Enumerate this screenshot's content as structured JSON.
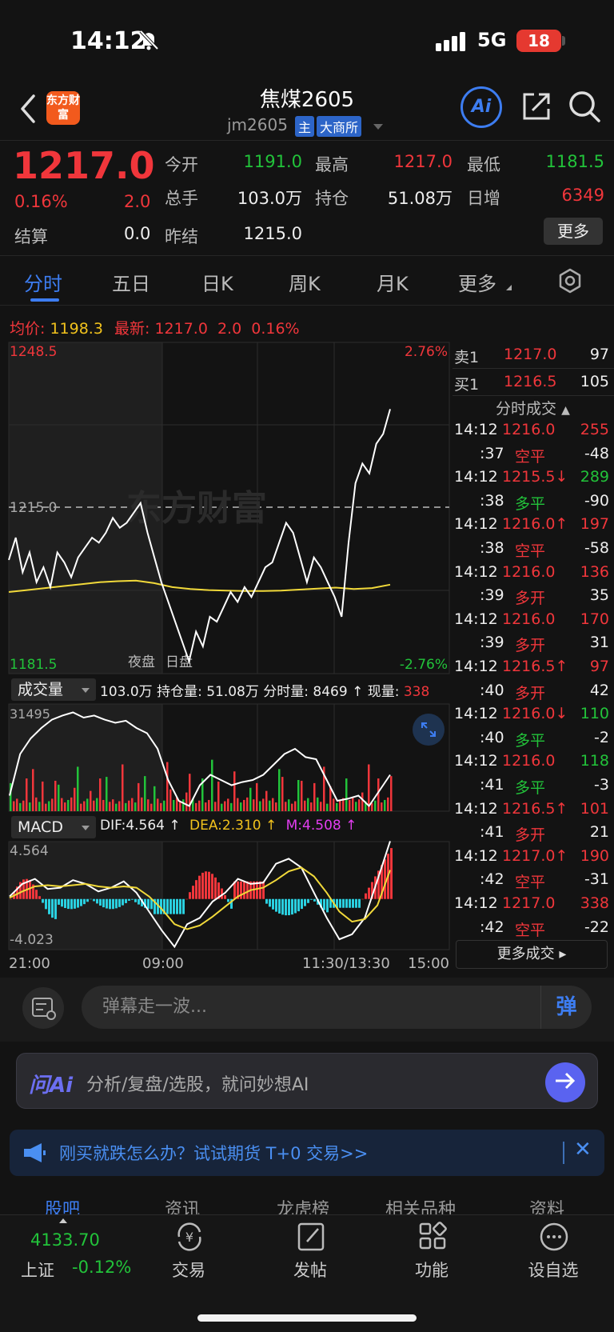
{
  "status": {
    "time": "14:12",
    "network": "5G",
    "battery": "18"
  },
  "header": {
    "logo": "东方财富",
    "title": "焦煤2605",
    "code": "jm2605",
    "tag_main": "主",
    "tag_exchange": "大商所"
  },
  "quote": {
    "price": "1217.0",
    "pct": "0.16%",
    "change": "2.0",
    "settle_label": "结算",
    "settle_value": "0.0",
    "open_label": "今开",
    "open_value": "1191.0",
    "high_label": "最高",
    "high_value": "1217.0",
    "low_label": "最低",
    "low_value": "1181.5",
    "vol_label": "总手",
    "vol_value": "103.0万",
    "oi_label": "持仓",
    "oi_value": "51.08万",
    "daily_inc_label": "日增",
    "daily_inc_value": "6349",
    "prev_settle_label": "昨结",
    "prev_settle_value": "1215.0",
    "more_label": "更多"
  },
  "tabs": [
    "分时",
    "五日",
    "日K",
    "周K",
    "月K",
    "更多"
  ],
  "info_line": {
    "avg_label": "均价:",
    "avg_value": "1198.3",
    "latest_label": "最新:",
    "latest_value": "1217.0",
    "latest_change": "2.0",
    "latest_pct": "0.16%"
  },
  "chart": {
    "price_high": "1248.5",
    "price_low": "1181.5",
    "price_ref": "1215.0",
    "pct_high": "2.76%",
    "pct_low": "-2.76%",
    "night_label": "夜盘",
    "day_label": "日盘",
    "watermark": "东方财富",
    "volume_selector": "成交量",
    "volume_info": "103.0万 持仓量: 51.08万 分时量: 8469 ↑ 现量:",
    "volume_now": "338",
    "volume_axis_max": "31495",
    "macd_selector": "MACD",
    "dif": "DIF:4.564 ↑",
    "dea": "DEA:2.310 ↑",
    "m": "M:4.508 ↑",
    "macd_max": "4.564",
    "macd_min": "-4.023",
    "time_ticks": [
      "21:00",
      "09:00",
      "11:30/13:30",
      "15:00"
    ],
    "colors": {
      "price_line": "#ffffff",
      "avg_line": "#f1d93a",
      "up": "#f0363b",
      "down": "#22c33a",
      "macd_neg": "#2ad0e0"
    }
  },
  "book": {
    "ask_label": "卖1",
    "ask_price": "1217.0",
    "ask_qty": "97",
    "bid_label": "买1",
    "bid_price": "1216.5",
    "bid_qty": "105",
    "trades_title": "分时成交",
    "trades": [
      {
        "t": "14:12",
        "p": "1216.0",
        "q": "255",
        "pc": "red",
        "qc": "red"
      },
      {
        "t": ":37",
        "p": "空平",
        "q": "-48",
        "pc": "red",
        "qc": "white"
      },
      {
        "t": "14:12",
        "p": "1215.5↓",
        "q": "289",
        "pc": "red",
        "qc": "green"
      },
      {
        "t": ":38",
        "p": "多平",
        "q": "-90",
        "pc": "green",
        "qc": "white"
      },
      {
        "t": "14:12",
        "p": "1216.0↑",
        "q": "197",
        "pc": "red",
        "qc": "red"
      },
      {
        "t": ":38",
        "p": "空平",
        "q": "-58",
        "pc": "red",
        "qc": "white"
      },
      {
        "t": "14:12",
        "p": "1216.0",
        "q": "136",
        "pc": "red",
        "qc": "red"
      },
      {
        "t": ":39",
        "p": "多开",
        "q": "35",
        "pc": "red",
        "qc": "white"
      },
      {
        "t": "14:12",
        "p": "1216.0",
        "q": "170",
        "pc": "red",
        "qc": "red"
      },
      {
        "t": ":39",
        "p": "多开",
        "q": "31",
        "pc": "red",
        "qc": "white"
      },
      {
        "t": "14:12",
        "p": "1216.5↑",
        "q": "97",
        "pc": "red",
        "qc": "red"
      },
      {
        "t": ":40",
        "p": "多开",
        "q": "42",
        "pc": "red",
        "qc": "white"
      },
      {
        "t": "14:12",
        "p": "1216.0↓",
        "q": "110",
        "pc": "red",
        "qc": "green"
      },
      {
        "t": ":40",
        "p": "多平",
        "q": "-2",
        "pc": "green",
        "qc": "white"
      },
      {
        "t": "14:12",
        "p": "1216.0",
        "q": "118",
        "pc": "red",
        "qc": "green"
      },
      {
        "t": ":41",
        "p": "多平",
        "q": "-3",
        "pc": "green",
        "qc": "white"
      },
      {
        "t": "14:12",
        "p": "1216.5↑",
        "q": "101",
        "pc": "red",
        "qc": "red"
      },
      {
        "t": ":41",
        "p": "多开",
        "q": "21",
        "pc": "red",
        "qc": "white"
      },
      {
        "t": "14:12",
        "p": "1217.0↑",
        "q": "190",
        "pc": "red",
        "qc": "red"
      },
      {
        "t": ":42",
        "p": "空平",
        "q": "-31",
        "pc": "red",
        "qc": "white"
      },
      {
        "t": "14:12",
        "p": "1217.0",
        "q": "338",
        "pc": "red",
        "qc": "red"
      },
      {
        "t": ":42",
        "p": "空平",
        "q": "-22",
        "pc": "red",
        "qc": "white"
      }
    ],
    "more_trades": "更多成交 ▸"
  },
  "danmu": {
    "placeholder": "弹幕走一波...",
    "send_label": "弹"
  },
  "ai_ask": {
    "logo": "问Ai",
    "text": "分析/复盘/选股，就问妙想AI"
  },
  "promo": {
    "text": "刚买就跌怎么办？试试期货 T+0 交易>>"
  },
  "subtabs": [
    "股吧",
    "资讯",
    "龙虎榜",
    "相关品种",
    "资料"
  ],
  "bottom_nav": {
    "index_value": "4133.70",
    "index_name": "上证",
    "index_pct": "-0.12%",
    "items": [
      "交易",
      "发帖",
      "功能",
      "设自选"
    ]
  }
}
